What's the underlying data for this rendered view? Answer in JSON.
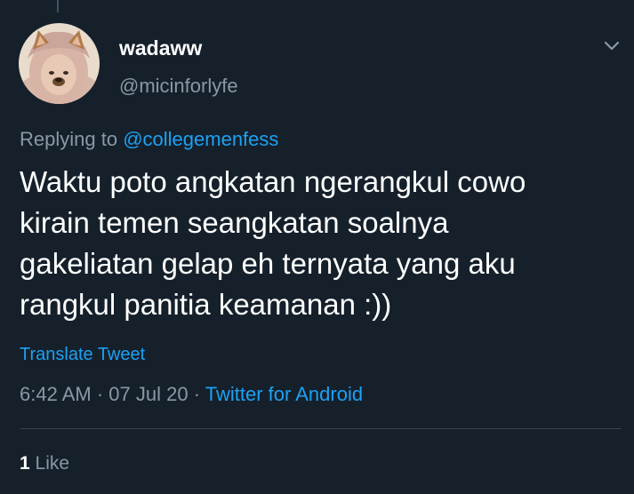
{
  "colors": {
    "background": "#15202b",
    "primary_text": "#ffffff",
    "secondary_text": "#8899a6",
    "accent": "#1da1f2",
    "divider": "#38444d"
  },
  "tweet": {
    "author": {
      "display_name": "wadaww",
      "handle": "@micinforlyfe",
      "avatar_icon": "avatar-photo-with-dog-filter"
    },
    "menu_icon": "chevron-down-icon",
    "replying_prefix": "Replying to",
    "replying_to": "@collegemenfess",
    "text_lines": [
      "Waktu poto angkatan ngerangkul cowo",
      "kirain temen seangkatan soalnya",
      "gakeliatan gelap eh ternyata yang aku",
      "rangkul panitia keamanan :))"
    ],
    "translate_label": "Translate Tweet",
    "time": "6:42 AM",
    "separator": "·",
    "date": "07 Jul 20",
    "source": "Twitter for Android",
    "like_count": "1",
    "like_label": "Like"
  }
}
